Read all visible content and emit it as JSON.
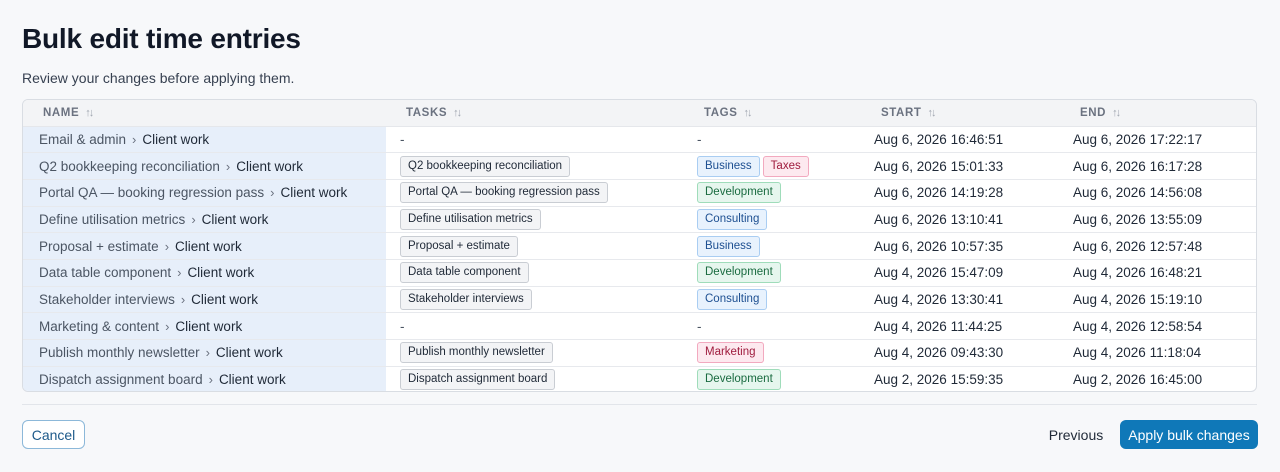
{
  "header": {
    "title": "Bulk edit time entries",
    "subtitle": "Review your changes before applying them."
  },
  "table": {
    "columns": [
      "NAME",
      "TASKS",
      "TAGS",
      "START",
      "END"
    ],
    "sort_glyph": "↑↓",
    "rows": [
      {
        "name": "Email & admin",
        "project": "Client work",
        "task": "",
        "tags": [],
        "start": "Aug 6, 2026 16:46:51",
        "end": "Aug 6, 2026 17:22:17"
      },
      {
        "name": "Q2 bookkeeping reconciliation",
        "project": "Client work",
        "task": "Q2 bookkeeping reconciliation",
        "tags": [
          {
            "label": "Business",
            "color": "blue"
          },
          {
            "label": "Taxes",
            "color": "red"
          }
        ],
        "start": "Aug 6, 2026 15:01:33",
        "end": "Aug 6, 2026 16:17:28"
      },
      {
        "name": "Portal QA — booking regression pass",
        "project": "Client work",
        "task": "Portal QA — booking regression pass",
        "tags": [
          {
            "label": "Development",
            "color": "green"
          }
        ],
        "start": "Aug 6, 2026 14:19:28",
        "end": "Aug 6, 2026 14:56:08"
      },
      {
        "name": "Define utilisation metrics",
        "project": "Client work",
        "task": "Define utilisation metrics",
        "tags": [
          {
            "label": "Consulting",
            "color": "blue"
          }
        ],
        "start": "Aug 6, 2026 13:10:41",
        "end": "Aug 6, 2026 13:55:09"
      },
      {
        "name": "Proposal + estimate",
        "project": "Client work",
        "task": "Proposal + estimate",
        "tags": [
          {
            "label": "Business",
            "color": "blue"
          }
        ],
        "start": "Aug 6, 2026 10:57:35",
        "end": "Aug 6, 2026 12:57:48"
      },
      {
        "name": "Data table component",
        "project": "Client work",
        "task": "Data table component",
        "tags": [
          {
            "label": "Development",
            "color": "green"
          }
        ],
        "start": "Aug 4, 2026 15:47:09",
        "end": "Aug 4, 2026 16:48:21"
      },
      {
        "name": "Stakeholder interviews",
        "project": "Client work",
        "task": "Stakeholder interviews",
        "tags": [
          {
            "label": "Consulting",
            "color": "blue"
          }
        ],
        "start": "Aug 4, 2026 13:30:41",
        "end": "Aug 4, 2026 15:19:10"
      },
      {
        "name": "Marketing & content",
        "project": "Client work",
        "task": "",
        "tags": [],
        "start": "Aug 4, 2026 11:44:25",
        "end": "Aug 4, 2026 12:58:54"
      },
      {
        "name": "Publish monthly newsletter",
        "project": "Client work",
        "task": "Publish monthly newsletter",
        "tags": [
          {
            "label": "Marketing",
            "color": "red"
          }
        ],
        "start": "Aug 4, 2026 09:43:30",
        "end": "Aug 4, 2026 11:18:04"
      },
      {
        "name": "Dispatch assignment board",
        "project": "Client work",
        "task": "Dispatch assignment board",
        "tags": [
          {
            "label": "Development",
            "color": "green"
          }
        ],
        "start": "Aug 2, 2026 15:59:35",
        "end": "Aug 2, 2026 16:45:00"
      }
    ],
    "empty_placeholder": "-"
  },
  "footer": {
    "cancel_label": "Cancel",
    "previous_label": "Previous",
    "apply_label": "Apply bulk changes"
  },
  "colors": {
    "primary": "#0f78b8",
    "name_column_bg": "#e7effa"
  }
}
